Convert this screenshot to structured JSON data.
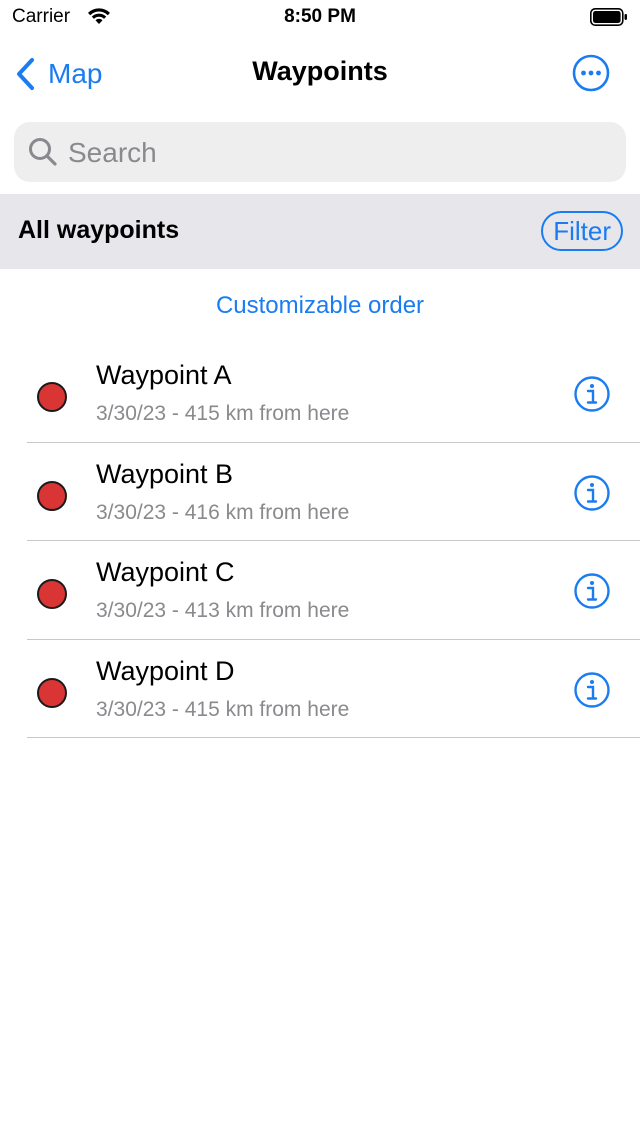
{
  "status_bar": {
    "carrier": "Carrier",
    "time": "8:50 PM",
    "icons": [
      "wifi-icon",
      "battery-icon"
    ]
  },
  "nav": {
    "back_label": "Map",
    "title": "Waypoints",
    "more_icon": "ellipsis-circle-icon"
  },
  "search": {
    "placeholder": "Search",
    "value": ""
  },
  "section": {
    "title": "All waypoints",
    "filter_label": "Filter"
  },
  "order_link": "Customizable order",
  "waypoints": [
    {
      "name": "Waypoint A",
      "detail": "3/30/23 - 415 km from here",
      "pin_color": "#d93535"
    },
    {
      "name": "Waypoint B",
      "detail": "3/30/23 - 416 km from here",
      "pin_color": "#d93535"
    },
    {
      "name": "Waypoint C",
      "detail": "3/30/23 - 413 km from here",
      "pin_color": "#d93535"
    },
    {
      "name": "Waypoint D",
      "detail": "3/30/23 - 415 km from here",
      "pin_color": "#d93535"
    }
  ],
  "colors": {
    "accent": "#1a7cf0",
    "secondary_text": "#8a8a8e",
    "section_bg": "#e6e6eb"
  }
}
